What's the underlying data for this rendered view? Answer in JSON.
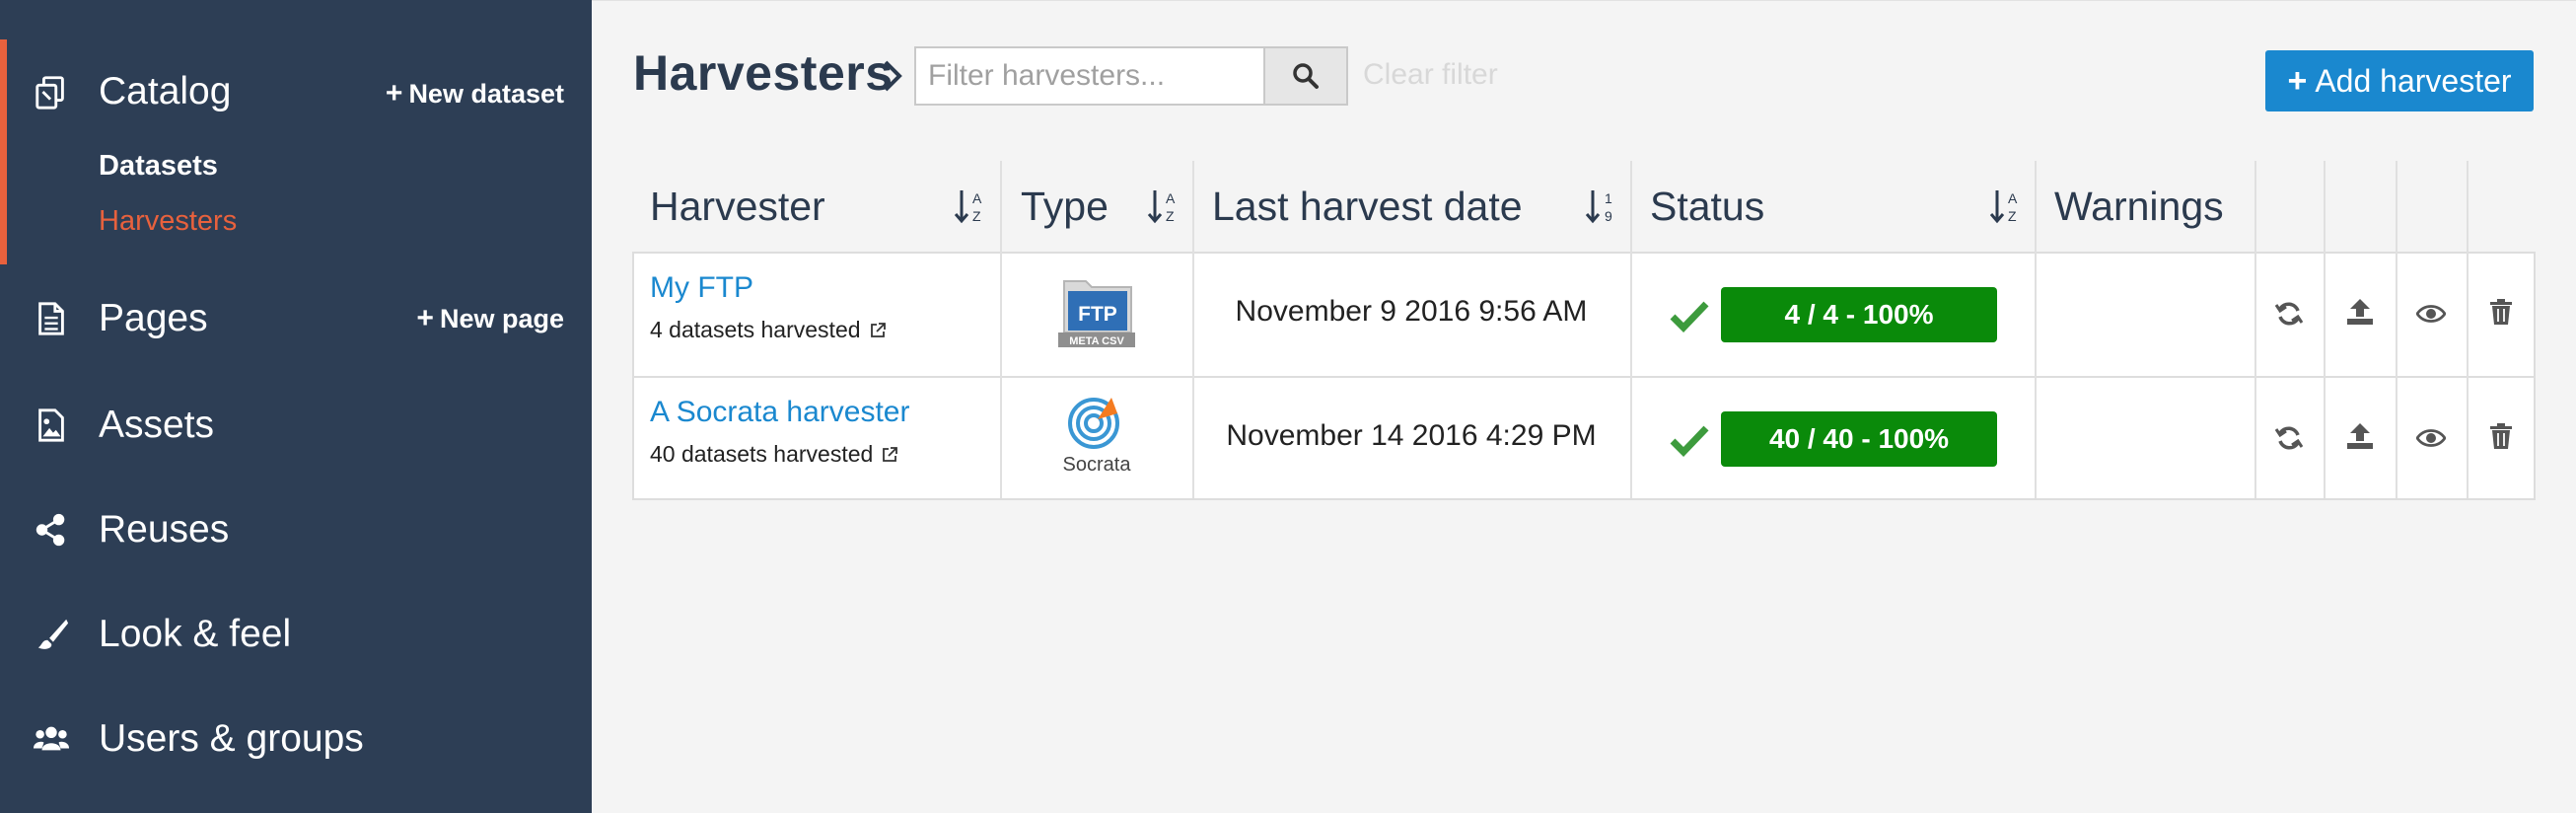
{
  "sidebar": {
    "items": [
      {
        "label": "Catalog",
        "icon": "catalog-icon",
        "action": "New dataset"
      },
      {
        "label": "Pages",
        "icon": "page-icon",
        "action": "New page"
      },
      {
        "label": "Assets",
        "icon": "image-icon"
      },
      {
        "label": "Reuses",
        "icon": "share-icon"
      },
      {
        "label": "Look & feel",
        "icon": "brush-icon"
      },
      {
        "label": "Users & groups",
        "icon": "users-icon"
      }
    ],
    "catalog_subitems": [
      {
        "label": "Datasets",
        "active": false
      },
      {
        "label": "Harvesters",
        "active": true
      }
    ],
    "accent_color": "#e8613d",
    "background_color": "#2d3e55"
  },
  "main": {
    "title": "Harvesters",
    "filter_placeholder": "Filter harvesters...",
    "clear_filter_label": "Clear filter",
    "add_button_label": "Add harvester",
    "table": {
      "columns": [
        {
          "label": "Harvester",
          "sortable": true
        },
        {
          "label": "Type",
          "sortable": true
        },
        {
          "label": "Last harvest date",
          "sortable": true
        },
        {
          "label": "Status",
          "sortable": true
        },
        {
          "label": "Warnings",
          "sortable": false
        }
      ],
      "rows": [
        {
          "name": "My FTP",
          "datasets": "4 datasets harvested",
          "type_label": "FTP",
          "type_sublabel": "META CSV",
          "date": "November 9 2016 9:56 AM",
          "status": "4 / 4 - 100%",
          "warnings": ""
        },
        {
          "name": "A Socrata harvester",
          "datasets": "40 datasets harvested",
          "type_label": "Socrata",
          "date": "November 14 2016 4:29 PM",
          "status": "40 / 40 - 100%",
          "warnings": ""
        }
      ],
      "row_actions": [
        "refresh-icon",
        "upload-icon",
        "eye-icon",
        "trash-icon"
      ]
    },
    "link_color": "#1a88cf",
    "status_color": "#0a8a0a"
  }
}
